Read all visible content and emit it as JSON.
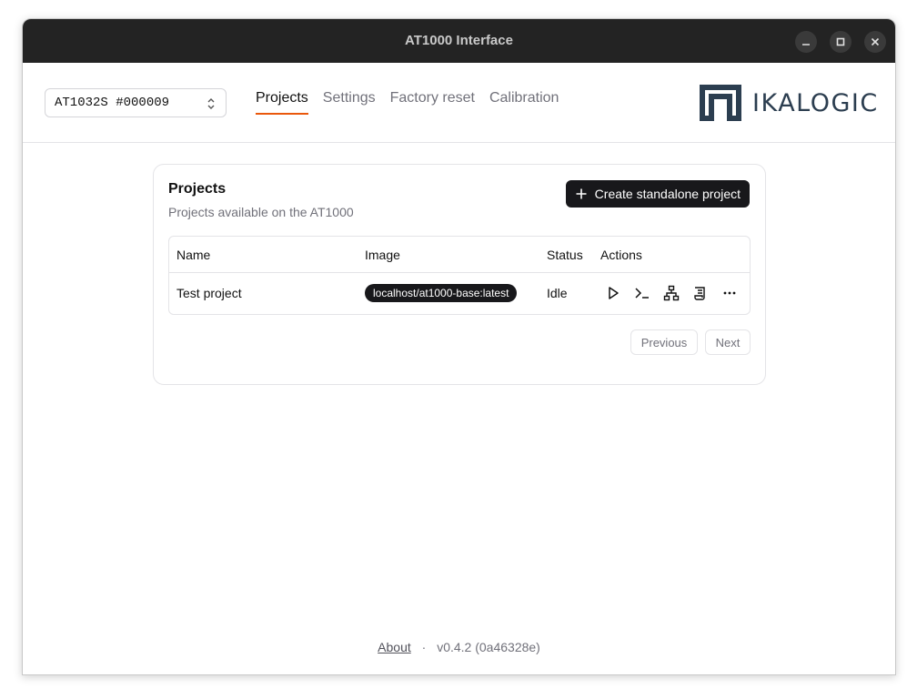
{
  "window": {
    "title": "AT1000 Interface"
  },
  "header": {
    "device": {
      "value": "AT1032S #000009"
    },
    "tabs": [
      {
        "label": "Projects",
        "active": true
      },
      {
        "label": "Settings",
        "active": false
      },
      {
        "label": "Factory reset",
        "active": false
      },
      {
        "label": "Calibration",
        "active": false
      }
    ],
    "logo_text": "IKALOGIC"
  },
  "card": {
    "title": "Projects",
    "subtitle": "Projects available on the AT1000",
    "create_label": "Create standalone project",
    "table": {
      "headers": [
        "Name",
        "Image",
        "Status",
        "Actions"
      ],
      "rows": [
        {
          "name": "Test project",
          "image": "localhost/at1000-base:latest",
          "status": "Idle"
        }
      ],
      "action_icons": [
        "play-icon",
        "terminal-icon",
        "network-icon",
        "scroll-log-icon",
        "more-icon"
      ]
    },
    "pagination": {
      "previous": "Previous",
      "next": "Next"
    }
  },
  "footer": {
    "about": "About",
    "separator": "·",
    "version": "v0.4.2 (0a46328e)"
  },
  "colors": {
    "accent": "#ea580c",
    "titlebar": "#232323",
    "button": "#18181b",
    "logo": "#2c3e50"
  }
}
